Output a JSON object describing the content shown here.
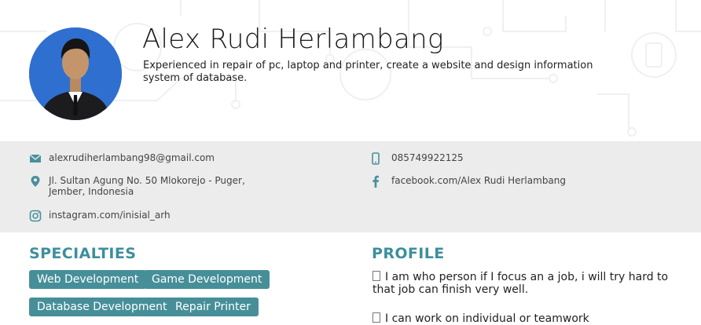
{
  "profile": {
    "name": "Alex Rudi Herlambang",
    "tagline": "Experienced in repair of pc, laptop and printer, create a website and design information system of database."
  },
  "contacts": {
    "email": "alexrudiherlambang98@gmail.com",
    "phone": "085749922125",
    "address": "Jl. Sultan Agung No. 50 Mlokorejo - Puger, Jember, Indonesia",
    "facebook": "facebook.com/Alex Rudi Herlambang",
    "instagram": "instagram.com/inisial_arh",
    "icons": [
      "mail-icon",
      "phone-icon",
      "location-pin-icon",
      "facebook-icon",
      "instagram-icon"
    ]
  },
  "specialties": {
    "title": "SPECIALTIES",
    "items": [
      "Web Development",
      "Game Development",
      "Database Development",
      "Repair Printer"
    ]
  },
  "profile_section": {
    "title": "PROFILE",
    "items": [
      "I am who person if I focus an a job, i will try hard to that job can finish very well.",
      "I can work on individual or teamwork"
    ]
  },
  "colors": {
    "accent": "#3d8f9c",
    "tag_bg": "#468f99",
    "contact_bg": "#ececec"
  }
}
